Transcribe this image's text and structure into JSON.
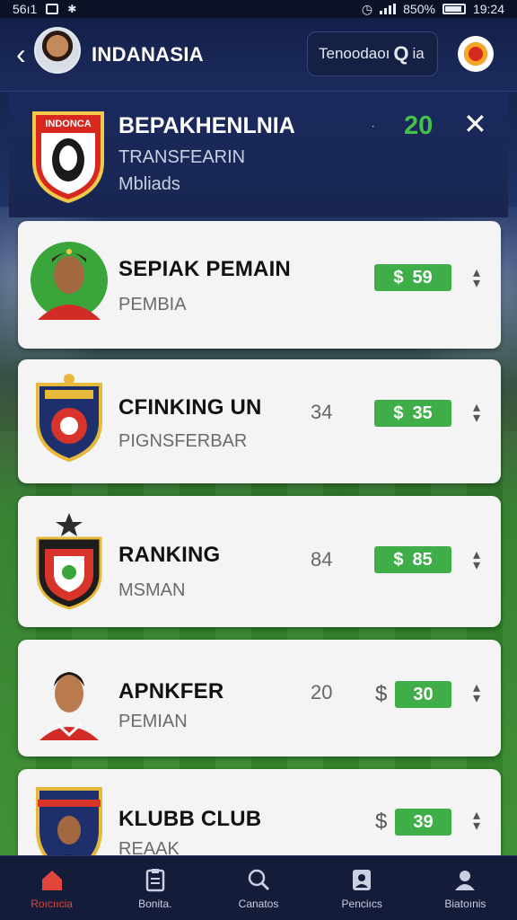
{
  "status_bar": {
    "left": "56ı1",
    "battery_text": "850%",
    "time": "19:24"
  },
  "app_bar": {
    "title": "INDANASIA",
    "search_text": "Tenoodaoı",
    "search_q": "Q",
    "search_suffix": "ia"
  },
  "header": {
    "title": "BEPAKHENLNIA",
    "subtitle": "TRANSFEARIN",
    "subtitle2": "Mbliads",
    "crest_text": "INDONCA",
    "count": "20"
  },
  "cards": [
    {
      "title": "SEPIAK PEMAIN",
      "subtitle": "PEMBIA",
      "number": "",
      "price": "59",
      "price_label": "$",
      "thumb": "player-photo"
    },
    {
      "title": "CFINKING UN",
      "subtitle": "PIGNSFERBAR",
      "number": "34",
      "price": "35",
      "price_label": "$",
      "thumb": "club-crest"
    },
    {
      "title": "RANKING",
      "subtitle": "MSMAN",
      "number": "84",
      "price": "85",
      "price_label": "$",
      "thumb": "club-crest-star"
    },
    {
      "title": "APNKFER",
      "subtitle": "PEMIAN",
      "number": "20",
      "price": "30",
      "price_label": "$",
      "thumb": "player-photo"
    },
    {
      "title": "KLUBB CLUB",
      "subtitle": "REAAK",
      "number": "",
      "price": "39",
      "price_label": "$",
      "thumb": "club-crest-player"
    }
  ],
  "bottom_nav": [
    {
      "label": "Roıcııcia",
      "icon": "home-icon",
      "active": true
    },
    {
      "label": "Bonita.",
      "icon": "clipboard-icon",
      "active": false
    },
    {
      "label": "Canatos",
      "icon": "search-icon",
      "active": false
    },
    {
      "label": "Penciıcs",
      "icon": "id-card-icon",
      "active": false
    },
    {
      "label": "Biatoınis",
      "icon": "profile-icon",
      "active": false
    }
  ],
  "colors": {
    "accent_green": "#3fae48",
    "count_green": "#43c04a",
    "nav_active": "#e2463a",
    "header_bg": "#1b2a5e"
  }
}
